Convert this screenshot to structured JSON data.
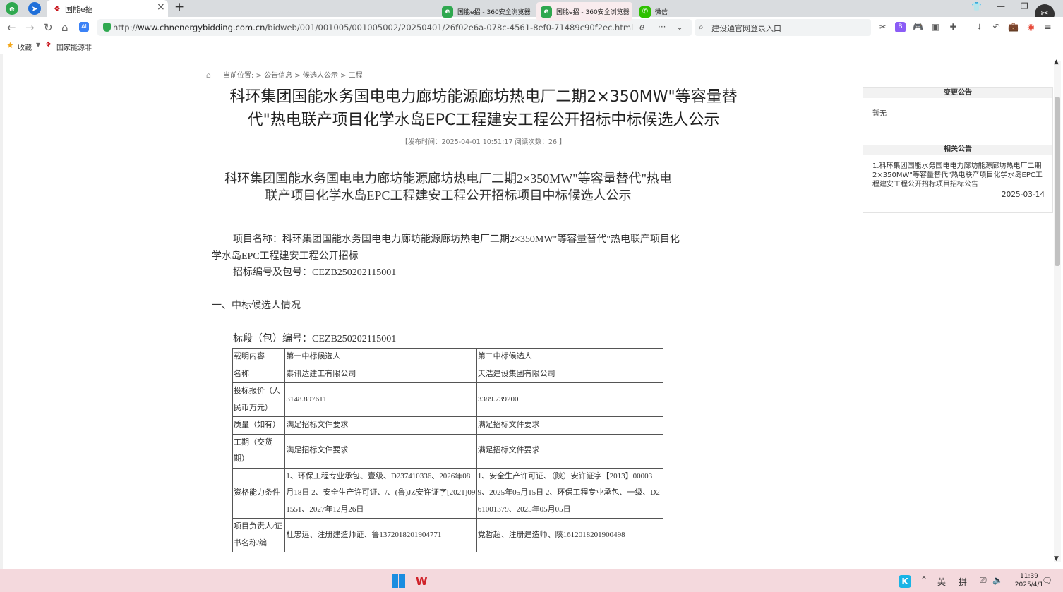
{
  "browser": {
    "tab_title": "国能e招",
    "url_prefix": "http://",
    "url_domain": "www.chnenergybidding.com.cn",
    "url_path": "/bidweb/001/001005/001005002/20250401/26f02e6a-078c-4561-8ef0-71489c90f2ec.html",
    "search_placeholder": "建设通官网登录入口",
    "bookmarks": {
      "favorites": "收藏",
      "site": "国家能源非"
    }
  },
  "page": {
    "breadcrumb": "当前位置: > 公告信息 > 候选人公示 > 工程",
    "title_line1": "科环集团国能水务国电电力廊坊能源廊坊热电厂二期2×350MW\"等容量替",
    "title_line2": "代\"热电联产项目化学水岛EPC工程建安工程公开招标中标候选人公示",
    "meta": "【发布时间：2025-04-01 10:51:17 阅读次数：26 】",
    "doc_title_line1": "科环集团国能水务国电电力廊坊能源廊坊热电厂二期2×350MW\"等容量替代\"热电",
    "doc_title_line2": "联产项目化学水岛EPC工程建安工程公开招标项目中标候选人公示",
    "project_name": "项目名称：科环集团国能水务国电电力廊坊能源廊坊热电厂二期2×350MW\"等容量替代\"热电联产项目化学水岛EPC工程建安工程公开招标",
    "bid_number": "招标编号及包号：CEZB250202115001",
    "section1": "一、中标候选人情况",
    "lot_number": "标段（包）编号：CEZB250202115001",
    "table": {
      "header": [
        "载明内容",
        "第一中标候选人",
        "第二中标候选人"
      ],
      "rows": [
        [
          "名称",
          "泰讯达建工有限公司",
          "天浩建设集团有限公司"
        ],
        [
          "投标报价（人民币万元）",
          "3148.897611",
          "3389.739200"
        ],
        [
          "质量（如有）",
          "满足招标文件要求",
          "满足招标文件要求"
        ],
        [
          "工期（交货期）",
          "满足招标文件要求",
          "满足招标文件要求"
        ],
        [
          "资格能力条件",
          "1、环保工程专业承包、壹级、D237410336、2026年08月18日 2、安全生产许可证、/、(鲁)JZ安许证字[2021]091551、2027年12月26日",
          "1、安全生产许可证、（陕）安许证字【2013】000039、2025年05月15日 2、环保工程专业承包、一级、D261001379、2025年05月05日"
        ],
        [
          "项目负责人/证书名称/编",
          "杜忠远、注册建造师证、鲁1372018201904771",
          "党哲超、注册建造师、陕1612018201900498"
        ]
      ]
    }
  },
  "side": {
    "change_title": "变更公告",
    "change_content": "暂无",
    "related_title": "相关公告",
    "related_item": "1.科环集团国能水务国电电力廊坊能源廊坊热电厂二期2×350MW\"等容量替代\"热电联产项目化学水岛EPC工程建安工程公开招标项目招标公告",
    "related_date": "2025-03-14"
  },
  "taskbar": {
    "app1": "国能e招 - 360安全浏览器",
    "app2": "国能e招 - 360安全浏览器",
    "app3": "微信",
    "ime1": "英",
    "ime2": "拼",
    "time": "11:39",
    "date": "2025/4/1"
  },
  "colors": {
    "taskbar": "#f4d9dd",
    "brand_red": "#c8161d",
    "browser_green": "#2fa84f"
  },
  "icons": [
    "back-icon",
    "forward-icon",
    "refresh-icon",
    "home-icon",
    "shield-icon",
    "search-icon",
    "star-icon",
    "windows-start-icon",
    "wps-icon",
    "wechat-icon"
  ]
}
